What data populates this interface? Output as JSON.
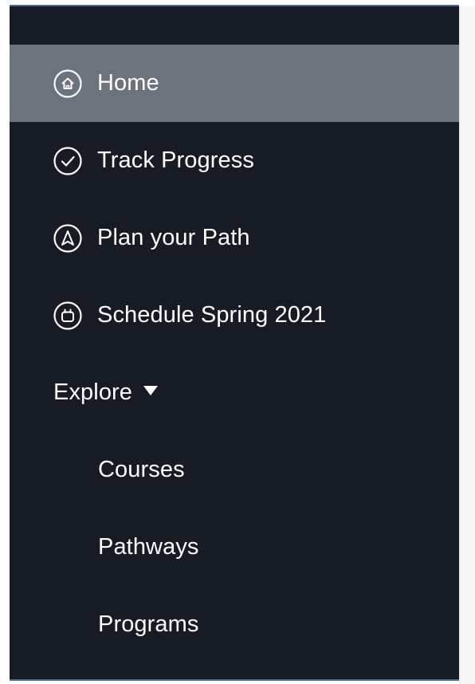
{
  "sidebar": {
    "items": [
      {
        "label": "Home",
        "icon": "home-icon",
        "active": true
      },
      {
        "label": "Track Progress",
        "icon": "check-circle-icon",
        "active": false
      },
      {
        "label": "Plan your Path",
        "icon": "navigation-icon",
        "active": false
      },
      {
        "label": "Schedule Spring 2021",
        "icon": "calendar-icon",
        "active": false
      }
    ],
    "explore": {
      "label": "Explore",
      "icon": "caret-down-icon",
      "expanded": true,
      "items": [
        {
          "label": "Courses"
        },
        {
          "label": "Pathways"
        },
        {
          "label": "Programs"
        }
      ]
    }
  },
  "colors": {
    "sidebar_bg": "#171b24",
    "active_bg": "#6c737d",
    "text": "#ffffff",
    "accent_line": "#4a6f8c"
  }
}
